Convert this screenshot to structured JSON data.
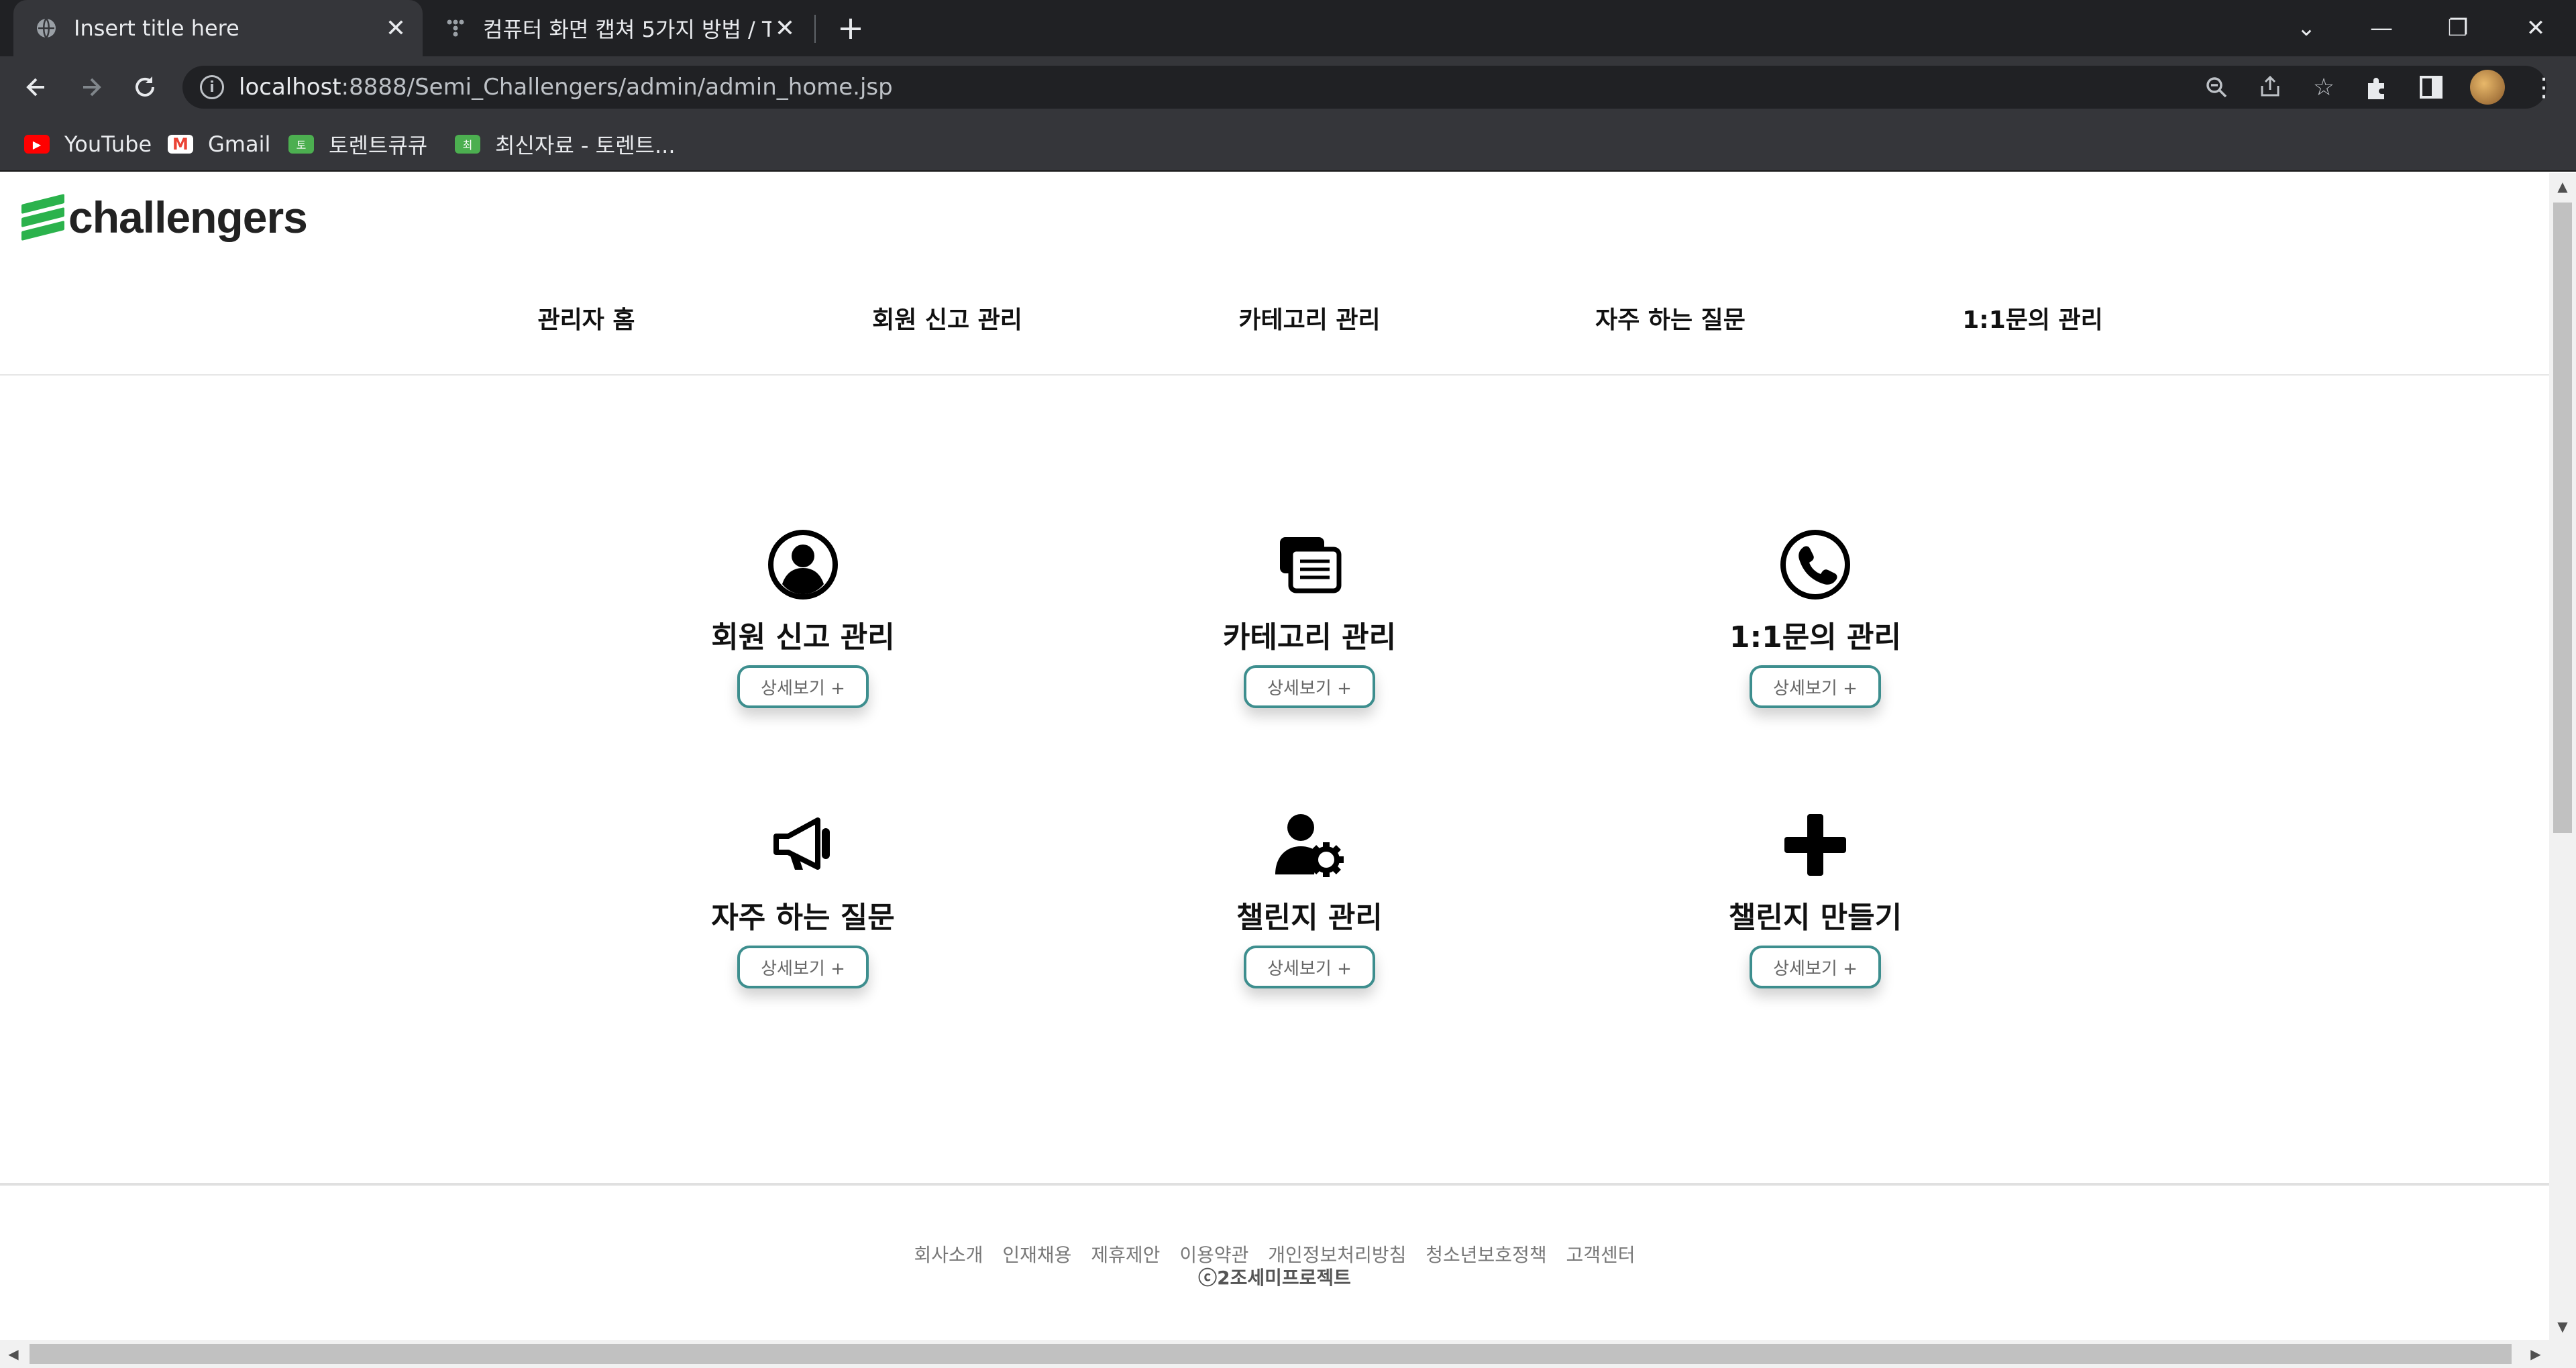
{
  "browser": {
    "tabs": [
      {
        "title": "Insert title here",
        "icon": "globe-icon"
      },
      {
        "title": "컴퓨터 화면 캡쳐 5가지 방법 / T",
        "icon": "tistory-icon"
      }
    ],
    "url_host": "localhost",
    "url_path": ":8888/Semi_Challengers/admin/admin_home.jsp",
    "bookmarks": [
      {
        "label": "YouTube",
        "icon": "youtube-icon",
        "color": "#ff0000"
      },
      {
        "label": "Gmail",
        "icon": "gmail-icon",
        "color": "#ea4335"
      },
      {
        "label": "토렌트큐큐",
        "icon": "torrent-icon",
        "color": "#4caf50"
      },
      {
        "label": "최신자료 - 토렌트...",
        "icon": "torrent-icon",
        "color": "#4caf50"
      }
    ]
  },
  "site": {
    "logo_text": "challengers",
    "brand_color": "#2bb24c",
    "nav": [
      {
        "label": "관리자 홈"
      },
      {
        "label": "회원 신고 관리"
      },
      {
        "label": "카테고리 관리"
      },
      {
        "label": "자주 하는 질문"
      },
      {
        "label": "1:1문의 관리"
      }
    ],
    "cards": [
      {
        "title": "회원 신고 관리",
        "icon": "user-circle-icon",
        "button": "상세보기 +"
      },
      {
        "title": "카테고리 관리",
        "icon": "documents-icon",
        "button": "상세보기 +"
      },
      {
        "title": "1:1문의 관리",
        "icon": "phone-icon",
        "button": "상세보기 +"
      },
      {
        "title": "자주 하는 질문",
        "icon": "megaphone-icon",
        "button": "상세보기 +"
      },
      {
        "title": "챌린지 관리",
        "icon": "user-gear-icon",
        "button": "상세보기 +"
      },
      {
        "title": "챌린지 만들기",
        "icon": "plus-icon",
        "button": "상세보기 +"
      }
    ],
    "accent_color": "#3d8e8e",
    "footer": {
      "links": [
        "회사소개",
        "인재채용",
        "제휴제안",
        "이용약관",
        "개인정보처리방침",
        "청소년보호정책",
        "고객센터"
      ],
      "copyright": "ⓒ2조세미프로젝트"
    }
  }
}
